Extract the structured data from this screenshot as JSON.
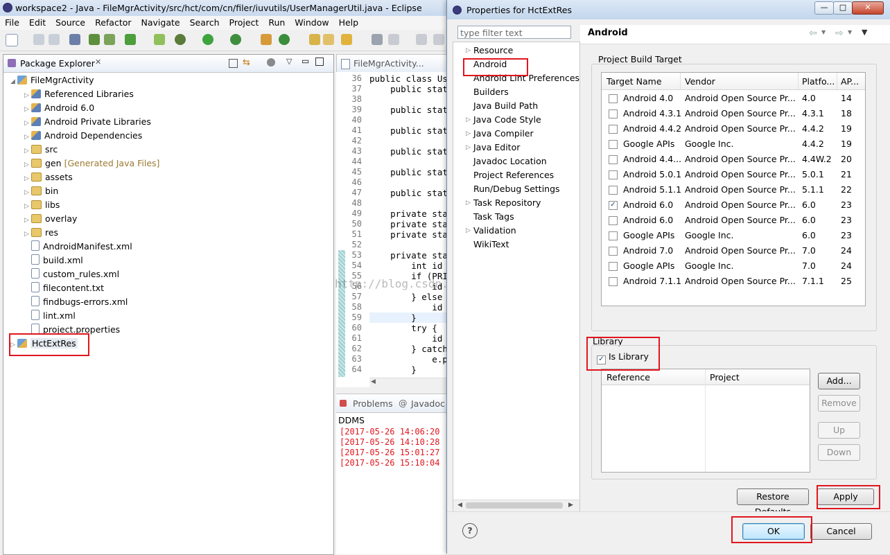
{
  "eclipse": {
    "title": "workspace2 - Java - FileMgrActivity/src/hct/com/cn/filer/iuvutils/UserManagerUtil.java - Eclipse",
    "menu": [
      "File",
      "Edit",
      "Source",
      "Refactor",
      "Navigate",
      "Search",
      "Project",
      "Run",
      "Window",
      "Help"
    ]
  },
  "package_explorer": {
    "title": "Package Explorer",
    "root": "FileMgrActivity",
    "items": [
      {
        "label": "Referenced Libraries",
        "icon": "library-icon"
      },
      {
        "label": "Android 6.0",
        "icon": "library-icon"
      },
      {
        "label": "Android Private Libraries",
        "icon": "library-icon"
      },
      {
        "label": "Android Dependencies",
        "icon": "library-icon"
      },
      {
        "label": "src",
        "icon": "source-folder-icon"
      },
      {
        "label": "gen",
        "icon": "source-folder-icon",
        "suffix": "[Generated Java Files]"
      },
      {
        "label": "assets",
        "icon": "folder-icon"
      },
      {
        "label": "bin",
        "icon": "folder-icon"
      },
      {
        "label": "libs",
        "icon": "folder-icon"
      },
      {
        "label": "overlay",
        "icon": "folder-icon"
      },
      {
        "label": "res",
        "icon": "folder-icon"
      },
      {
        "label": "AndroidManifest.xml",
        "icon": "xml-file-icon"
      },
      {
        "label": "build.xml",
        "icon": "xml-file-icon"
      },
      {
        "label": "custom_rules.xml",
        "icon": "xml-file-icon"
      },
      {
        "label": "filecontent.txt",
        "icon": "text-file-icon"
      },
      {
        "label": "findbugs-errors.xml",
        "icon": "xml-file-icon"
      },
      {
        "label": "lint.xml",
        "icon": "xml-file-icon"
      },
      {
        "label": "project.properties",
        "icon": "text-file-icon"
      }
    ],
    "second_project": "HctExtRes"
  },
  "editor": {
    "tab": "FileMgrActivity...",
    "lines": [
      {
        "n": "36",
        "code": "public class Use"
      },
      {
        "n": "37",
        "code": "    public stati"
      },
      {
        "n": "38",
        "code": ""
      },
      {
        "n": "39",
        "code": "    public stati"
      },
      {
        "n": "40",
        "code": ""
      },
      {
        "n": "41",
        "code": "    public stati"
      },
      {
        "n": "42",
        "code": ""
      },
      {
        "n": "43",
        "code": "    public stati"
      },
      {
        "n": "44",
        "code": ""
      },
      {
        "n": "45",
        "code": "    public stati"
      },
      {
        "n": "46",
        "code": ""
      },
      {
        "n": "47",
        "code": "    public stati"
      },
      {
        "n": "48",
        "code": ""
      },
      {
        "n": "49",
        "code": "    private stat"
      },
      {
        "n": "50",
        "code": "    private stat"
      },
      {
        "n": "51",
        "code": "    private stat"
      },
      {
        "n": "52",
        "code": ""
      },
      {
        "n": "53",
        "code": "    private stat"
      },
      {
        "n": "54",
        "code": "        int id ="
      },
      {
        "n": "55",
        "code": "        if (PRIV"
      },
      {
        "n": "56",
        "code": "            id ="
      },
      {
        "n": "57",
        "code": "        } else i"
      },
      {
        "n": "58",
        "code": "            id ="
      },
      {
        "n": "59",
        "code": "        }"
      },
      {
        "n": "60",
        "code": "        try {"
      },
      {
        "n": "61",
        "code": "            id ="
      },
      {
        "n": "62",
        "code": "        } catch"
      },
      {
        "n": "63",
        "code": "            e.pr"
      },
      {
        "n": "64",
        "code": "        }"
      }
    ],
    "watermark": "http://blog.csdn.net/Someday_spark"
  },
  "bottom_panel": {
    "tabs": [
      "Problems",
      "Javadoc"
    ],
    "console_title": "DDMS",
    "log": [
      "[2017-05-26 14:06:20 -",
      "[2017-05-26 14:10:28 -",
      "[2017-05-26 15:01:27 -",
      "[2017-05-26 15:10:04 -"
    ]
  },
  "dialog": {
    "title": "Properties for HctExtRes",
    "filter_placeholder": "type filter text",
    "nav": [
      {
        "label": "Resource",
        "expandable": true
      },
      {
        "label": "Android",
        "expandable": false,
        "selected": true
      },
      {
        "label": "Android Lint Preferences",
        "expandable": false
      },
      {
        "label": "Builders",
        "expandable": false
      },
      {
        "label": "Java Build Path",
        "expandable": false
      },
      {
        "label": "Java Code Style",
        "expandable": true
      },
      {
        "label": "Java Compiler",
        "expandable": true
      },
      {
        "label": "Java Editor",
        "expandable": true
      },
      {
        "label": "Javadoc Location",
        "expandable": false
      },
      {
        "label": "Project References",
        "expandable": false
      },
      {
        "label": "Run/Debug Settings",
        "expandable": false
      },
      {
        "label": "Task Repository",
        "expandable": true
      },
      {
        "label": "Task Tags",
        "expandable": false
      },
      {
        "label": "Validation",
        "expandable": true
      },
      {
        "label": "WikiText",
        "expandable": false
      }
    ],
    "page_title": "Android",
    "build_target": {
      "group_label": "Project Build Target",
      "headers": [
        "Target Name",
        "Vendor",
        "Platfo...",
        "AP..."
      ],
      "rows": [
        {
          "checked": false,
          "name": "Android 4.0",
          "vendor": "Android Open Source Pr...",
          "platform": "4.0",
          "api": "14"
        },
        {
          "checked": false,
          "name": "Android 4.3.1",
          "vendor": "Android Open Source Pr...",
          "platform": "4.3.1",
          "api": "18"
        },
        {
          "checked": false,
          "name": "Android 4.4.2",
          "vendor": "Android Open Source Pr...",
          "platform": "4.4.2",
          "api": "19"
        },
        {
          "checked": false,
          "name": "Google APIs",
          "vendor": "Google Inc.",
          "platform": "4.4.2",
          "api": "19"
        },
        {
          "checked": false,
          "name": "Android 4.4...",
          "vendor": "Android Open Source Pr...",
          "platform": "4.4W.2",
          "api": "20"
        },
        {
          "checked": false,
          "name": "Android 5.0.1",
          "vendor": "Android Open Source Pr...",
          "platform": "5.0.1",
          "api": "21"
        },
        {
          "checked": false,
          "name": "Android 5.1.1",
          "vendor": "Android Open Source Pr...",
          "platform": "5.1.1",
          "api": "22"
        },
        {
          "checked": true,
          "name": "Android 6.0",
          "vendor": "Android Open Source Pr...",
          "platform": "6.0",
          "api": "23"
        },
        {
          "checked": false,
          "name": "Android 6.0",
          "vendor": "Android Open Source Pr...",
          "platform": "6.0",
          "api": "23"
        },
        {
          "checked": false,
          "name": "Google APIs",
          "vendor": "Google Inc.",
          "platform": "6.0",
          "api": "23"
        },
        {
          "checked": false,
          "name": "Android 7.0",
          "vendor": "Android Open Source Pr...",
          "platform": "7.0",
          "api": "24"
        },
        {
          "checked": false,
          "name": "Google APIs",
          "vendor": "Google Inc.",
          "platform": "7.0",
          "api": "24"
        },
        {
          "checked": false,
          "name": "Android 7.1.1",
          "vendor": "Android Open Source Pr...",
          "platform": "7.1.1",
          "api": "25"
        }
      ]
    },
    "library": {
      "group_label": "Library",
      "is_library_label": "Is Library",
      "is_library_checked": true,
      "headers": [
        "Reference",
        "Project"
      ],
      "buttons": {
        "add": "Add...",
        "remove": "Remove",
        "up": "Up",
        "down": "Down"
      }
    },
    "restore_defaults": "Restore Defaults",
    "apply": "Apply",
    "ok": "OK",
    "cancel": "Cancel",
    "help_glyph": "?"
  },
  "colors": {
    "highlight_box": "#e0161d",
    "selection": "#3399ff"
  }
}
